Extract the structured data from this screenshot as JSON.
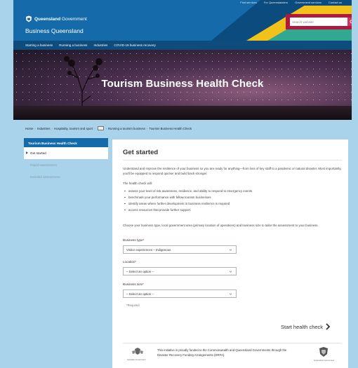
{
  "header": {
    "utility_links": [
      "Find services",
      "For Queenslanders",
      "Government services",
      "Contact us"
    ],
    "gov_name_bold": "Queensland",
    "gov_name_rest": " Government",
    "site_title": "Business Queensland",
    "search_placeholder": "Search website"
  },
  "nav": {
    "items": [
      "Starting a business",
      "Running a business",
      "Industries",
      "COVID-19 business recovery"
    ]
  },
  "banner": {
    "title": "Tourism Business Health Check"
  },
  "breadcrumb": {
    "items": [
      "Home",
      "Industries",
      "Hospitality, tourism and sport",
      "Running a tourism business",
      "Tourism Business Health Check"
    ],
    "separator": "›"
  },
  "sidebar": {
    "title": "Tourism Business Health Check",
    "items": [
      "Get started",
      "Rapid assessment",
      "Detailed assessment"
    ]
  },
  "main": {
    "heading": "Get started",
    "intro": "Understand and improve the resilience of your business so you are ready for anything—from loss of key staff to a pandemic or natural disaster. Most importantly, you'll be equipped to respond quicker and build back stronger.",
    "list_intro": "The health check will:",
    "bullets": [
      "assess your level of risk awareness, resilience, and ability to respond to emergency events",
      "benchmark your performance with fellow tourism businesses",
      "identify areas where further development in business resilience is required",
      "access resources that provide further support."
    ],
    "choose_text": "Choose your business type, local government area (primary location of operations) and business size to tailor the assessment to your business.",
    "business_type_label": "Business type*",
    "business_type_value": "Visitor experiences – Indigenous",
    "location_label": "Location*",
    "location_value": "– Select an option –",
    "business_size_label": "Business size*",
    "business_size_value": "– Select an option –",
    "required_note": "*Required",
    "start_button": "Start health check",
    "funding_text": "This initiative is proudly funded to the Commonwealth and Queensland Governments through the Disaster Recovery Funding Arrangements (DRFA).",
    "crest_left_caption": "Australian Government",
    "crest_right_caption": "Queensland Government"
  },
  "colors": {
    "header_blue": "#156aaa",
    "nav_navy": "#0e4c7e",
    "search_maroon": "#b0183e",
    "accent_yellow": "#f2c21a",
    "accent_teal": "#32a890",
    "page_bg": "#a9d3ea"
  }
}
